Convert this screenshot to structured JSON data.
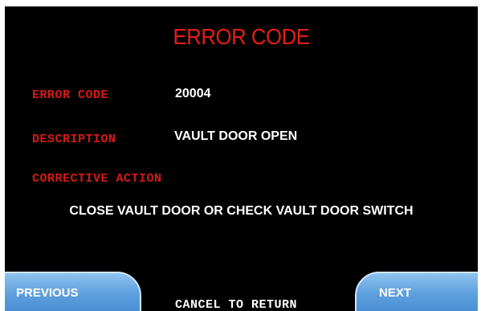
{
  "header": {
    "title": "ERROR CODE"
  },
  "fields": {
    "error_code_label": "ERROR CODE",
    "error_code_value": "20004",
    "description_label": "DESCRIPTION",
    "description_value": "VAULT DOOR OPEN",
    "corrective_action_label": "CORRECTIVE ACTION",
    "corrective_action_value": "CLOSE VAULT DOOR OR CHECK VAULT DOOR SWITCH"
  },
  "navigation": {
    "previous_label": "PREVIOUS",
    "next_label": "NEXT",
    "cancel_label": "CANCEL TO RETURN"
  },
  "colors": {
    "background": "#000000",
    "title": "#e41e14",
    "label": "#d81a14",
    "value": "#ffffff",
    "button": "#5d9fdd"
  }
}
